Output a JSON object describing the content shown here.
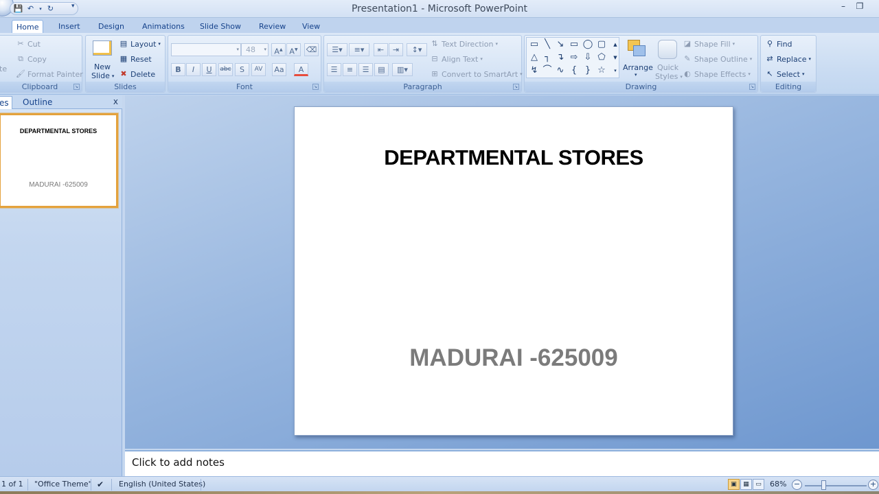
{
  "window": {
    "title": "Presentation1 - Microsoft PowerPoint"
  },
  "tabs": [
    "Home",
    "Insert",
    "Design",
    "Animations",
    "Slide Show",
    "Review",
    "View"
  ],
  "ribbon": {
    "clipboard": {
      "label": "Clipboard",
      "cut": "Cut",
      "copy": "Copy",
      "format_painter": "Format Painter",
      "paste_partial": "te"
    },
    "slides": {
      "label": "Slides",
      "new_slide_line1": "New",
      "new_slide_line2": "Slide",
      "layout": "Layout",
      "reset": "Reset",
      "delete": "Delete"
    },
    "font": {
      "label": "Font",
      "font_name": "",
      "font_size": "48"
    },
    "paragraph": {
      "label": "Paragraph",
      "text_direction": "Text Direction",
      "align_text": "Align Text",
      "convert_smartart": "Convert to SmartArt"
    },
    "drawing": {
      "label": "Drawing",
      "arrange": "Arrange",
      "quick_styles_line1": "Quick",
      "quick_styles_line2": "Styles",
      "shape_fill": "Shape Fill",
      "shape_outline": "Shape Outline",
      "shape_effects": "Shape Effects"
    },
    "editing": {
      "label": "Editing",
      "find": "Find",
      "replace": "Replace",
      "select": "Select"
    }
  },
  "left_pane": {
    "tab_slides_partial": "es",
    "tab_outline": "Outline",
    "close": "x",
    "thumbnail": {
      "title": "DEPARTMENTAL STORES",
      "subtitle": "MADURAI -625009"
    }
  },
  "slide": {
    "title": "DEPARTMENTAL STORES",
    "subtitle": "MADURAI -625009"
  },
  "notes": {
    "placeholder": "Click to add notes"
  },
  "status": {
    "slide_info": "1 of 1",
    "theme": "\"Office Theme\"",
    "language": "English (United States)",
    "zoom": "68%"
  },
  "colors": {
    "accent": "#15428b",
    "thumbnail_border": "#e4a23d",
    "subtitle_gray": "#7b7b7b"
  }
}
